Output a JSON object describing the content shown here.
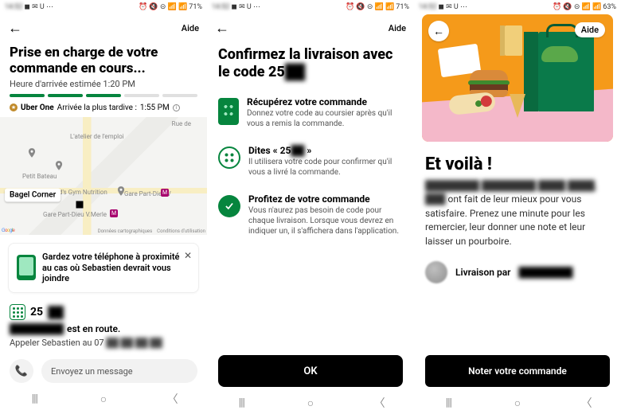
{
  "statusbar": {
    "time_blur": "14:52",
    "icons_left": "◼︎ ✉︎ U ⋯",
    "icons_right": "⏰ 🔇 ⊝ 📶 📶",
    "battery1": "71%",
    "battery2": "71%",
    "battery3": "63%"
  },
  "common": {
    "aide": "Aide",
    "nav_recents": "|||",
    "nav_home": "○",
    "nav_back": "〈"
  },
  "screen1": {
    "title": "Prise en charge de votre commande en cours...",
    "eta_label": "Heure d'arrivée estimée",
    "eta_value": "1:20 PM",
    "uberone": "Uber One",
    "latest_label": "Arrivée la plus tardive :",
    "latest_value": "1:55 PM",
    "map": {
      "pickup_chip": "Bagel Corner",
      "poi1": "L'atelier de l'emploi",
      "poi2": "Petit Bateau",
      "poi3": "Gold's Gym Nutrition",
      "station1": "Gare Part-Dieu V",
      "station2": "Gare Part-Dieu V.Merle",
      "street": "Rue de",
      "attrib_data": "Données cartographiques",
      "attrib_terms": "Conditions d'utilisation"
    },
    "card_text": "Gardez votre téléphone à proximité au cas où Sebastien devrait vous joindre",
    "code": "25",
    "code_blur": "██",
    "route_blur": "████████",
    "route_suffix": "est en route.",
    "call_label": "Appeler Sebastien au 07",
    "call_blur": "██ ██ ██ ██",
    "msg_placeholder": "Envoyez un message"
  },
  "screen2": {
    "title_pre": "Confirmez la livraison avec le code 25",
    "title_blur": "██",
    "step1_h": "Récupérez votre commande",
    "step1_sub": "Donnez votre code au coursier après qu'il vous a remis la commande.",
    "step2_h_pre": "Dites « 25",
    "step2_h_blur": "██",
    "step2_h_post": " »",
    "step2_sub": "Il utilisera votre code pour confirmer qu'il vous a livré la commande.",
    "step3_h": "Profitez de votre commande",
    "step3_sub": "Vous n'aurez pas besoin de code pour chaque livraison. Lorsque vous devrez en indiquer un, il s'affichera dans l'application.",
    "ok": "OK"
  },
  "screen3": {
    "title": "Et voilà !",
    "body_blur1": "████████ ████████ ████ ████, ███",
    "body_rest": " ont fait de leur mieux pour vous satisfaire. Prenez une minute pour les remercier, leur donner une note et leur laisser un pourboire.",
    "courier_label": "Livraison par",
    "courier_blur": "████████",
    "rate": "Noter votre commande"
  }
}
